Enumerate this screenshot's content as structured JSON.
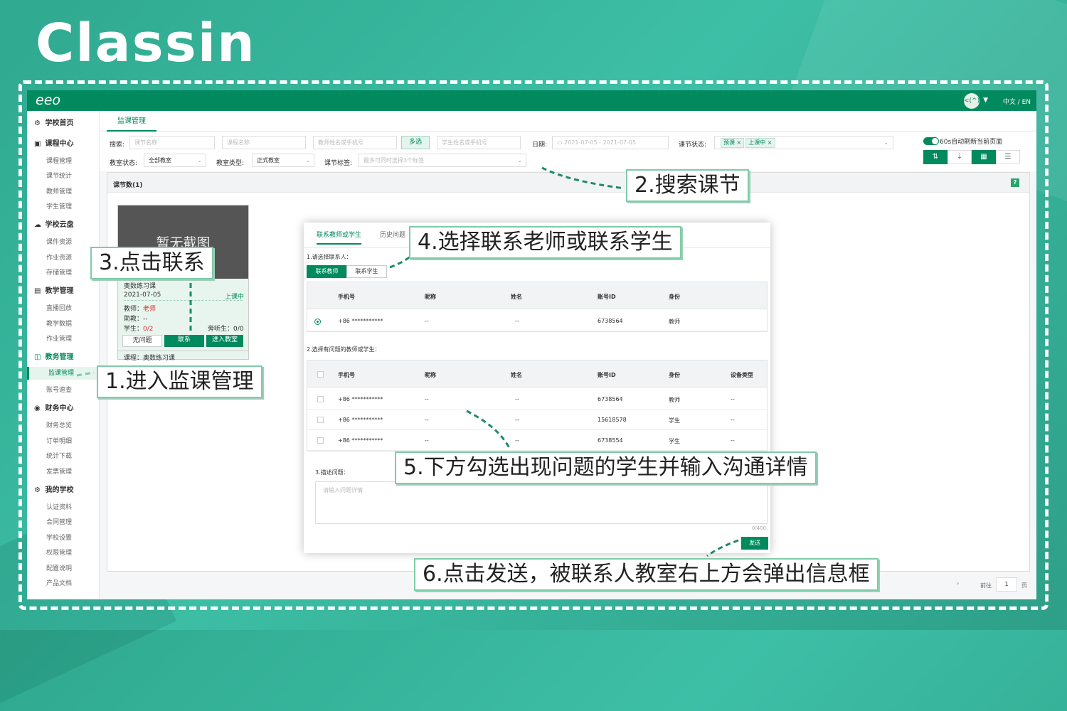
{
  "brand": {
    "logo": "Classin",
    "app_logo": "eeo"
  },
  "topbar": {
    "avatar_label": "<(^)>",
    "lang": "中文 / EN"
  },
  "sidebar": {
    "sections": [
      {
        "label": "学校首页",
        "items": []
      },
      {
        "label": "课程中心",
        "items": [
          "课程管理",
          "课节统计",
          "教师管理",
          "学生管理"
        ]
      },
      {
        "label": "学校云盘",
        "items": [
          "课件资源",
          "作业资源",
          "存储管理"
        ]
      },
      {
        "label": "教学管理",
        "items": [
          "直播回放",
          "教学数据",
          "作业管理"
        ]
      },
      {
        "label": "教务管理",
        "items": [
          "监课管理",
          "账号速查"
        ]
      },
      {
        "label": "财务中心",
        "items": [
          "财务总览",
          "订单明细",
          "统计下载",
          "发票管理"
        ]
      },
      {
        "label": "我的学校",
        "items": [
          "认证资料",
          "合同管理",
          "学校设置",
          "权限管理",
          "配置说明",
          "产品文档"
        ]
      }
    ],
    "active_item": "监课管理"
  },
  "tabs": {
    "active": "监课管理"
  },
  "filters": {
    "search_label": "搜索:",
    "course_name_ph": "课节名称",
    "class_name_ph": "课程名称",
    "teacher_ph": "教师姓名或手机号",
    "multi_btn": "多选",
    "student_ph": "学生姓名或手机号",
    "date_label": "日期:",
    "date_range": "2021-07-05  - 2021-07-05",
    "status_label": "课节状态:",
    "status_tags": [
      "预课 ×",
      "上课中 ×"
    ],
    "room_state_label": "教室状态:",
    "room_state_value": "全部教室",
    "room_type_label": "教室类型:",
    "room_type_value": "正式教室",
    "course_tag_label": "课节标签:",
    "course_tag_ph": "最多可同时选择3个标签",
    "auto_refresh": "60s自动刷新当前页面"
  },
  "panel": {
    "title": "课节数(1)",
    "help": "?"
  },
  "card": {
    "screenshot_text": "暂无截图",
    "course": "奥数练习课",
    "date": "2021-07-05",
    "status": "上课中",
    "teacher_label": "教师：",
    "teacher_value": "老师",
    "assistant": "助教：--",
    "student_label": "学生：",
    "student_value": "0/2",
    "auditor": "旁听生：0/0",
    "btn_no_issue": "无问题",
    "btn_contact": "联系",
    "btn_enter": "进入教室",
    "footer": "课程：奥数练习课"
  },
  "pager": {
    "goto": "前往",
    "page": "1",
    "unit": "页",
    "arrow": "›"
  },
  "dialog": {
    "tabs": [
      "联系教师或学生",
      "历史问题"
    ],
    "step1": "1.请选择联系人：",
    "seg": [
      "联系教师",
      "联系学生"
    ],
    "headers1": [
      "手机号",
      "昵称",
      "姓名",
      "账号ID",
      "身份"
    ],
    "rows1": [
      [
        "+86 ***********",
        "--",
        "--",
        "6738564",
        "教师"
      ]
    ],
    "step2": "2.选择有问题的教师或学生：",
    "headers2": [
      "手机号",
      "昵称",
      "姓名",
      "账号ID",
      "身份",
      "设备类型"
    ],
    "rows2": [
      [
        "+86 ***********",
        "--",
        "--",
        "6738564",
        "教师",
        "--"
      ],
      [
        "+86 ***********",
        "--",
        "--",
        "15618578",
        "学生",
        "--"
      ],
      [
        "+86 ***********",
        "--",
        "--",
        "6738554",
        "学生",
        "--"
      ]
    ],
    "step3": "3.描述问题：",
    "textarea_ph": "请输入问题详情",
    "counter": "0/400",
    "send": "发送"
  },
  "callouts": {
    "c1": "1.进入监课管理",
    "c2": "2.搜索课节",
    "c3": "3.点击联系",
    "c4": "4.选择联系老师或联系学生",
    "c5": "5.下方勾选出现问题的学生并输入沟通详情",
    "c6": "6.点击发送，被联系人教室右上方会弹出信息框"
  },
  "colors": {
    "brand_green": "#008a5e",
    "bg_teal": "#3dbfa6",
    "callout_border": "#7ecba8"
  }
}
